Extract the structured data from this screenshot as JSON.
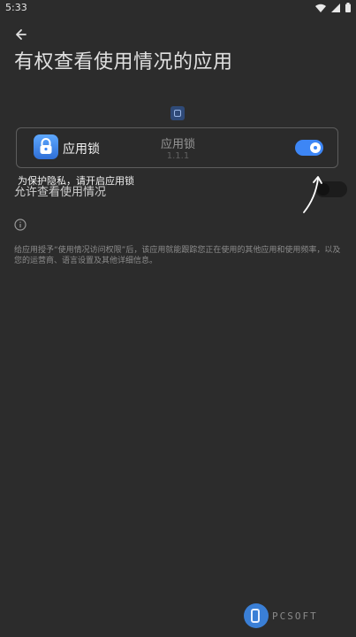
{
  "status_bar": {
    "time": "5:33",
    "icons": [
      "wifi-icon",
      "signal-icon",
      "battery-icon"
    ]
  },
  "header": {
    "back_icon": "arrow-left-icon",
    "title": "有权查看使用情况的应用"
  },
  "app_detail": {
    "icon": "app-lock-icon",
    "name": "应用锁",
    "version": "1.1.1",
    "permission_label": "允许查看使用情况",
    "permission_enabled": false,
    "info_icon": "info-icon",
    "info_text": "给应用授予“使用情况访问权限”后，该应用就能跟踪您正在使用的其他应用和使用频率，以及您的运营商、语言设置及其他详细信息。"
  },
  "overlay_guide": {
    "app_icon": "lock-icon",
    "app_name": "应用锁",
    "toggle_on": true,
    "hint": "为保护隐私，请开启应用锁",
    "pointer_icon": "curved-arrow-icon"
  },
  "watermark": {
    "text": "PCSOFT"
  },
  "colors": {
    "background": "#2c2c2c",
    "accent": "#3d86f5"
  }
}
